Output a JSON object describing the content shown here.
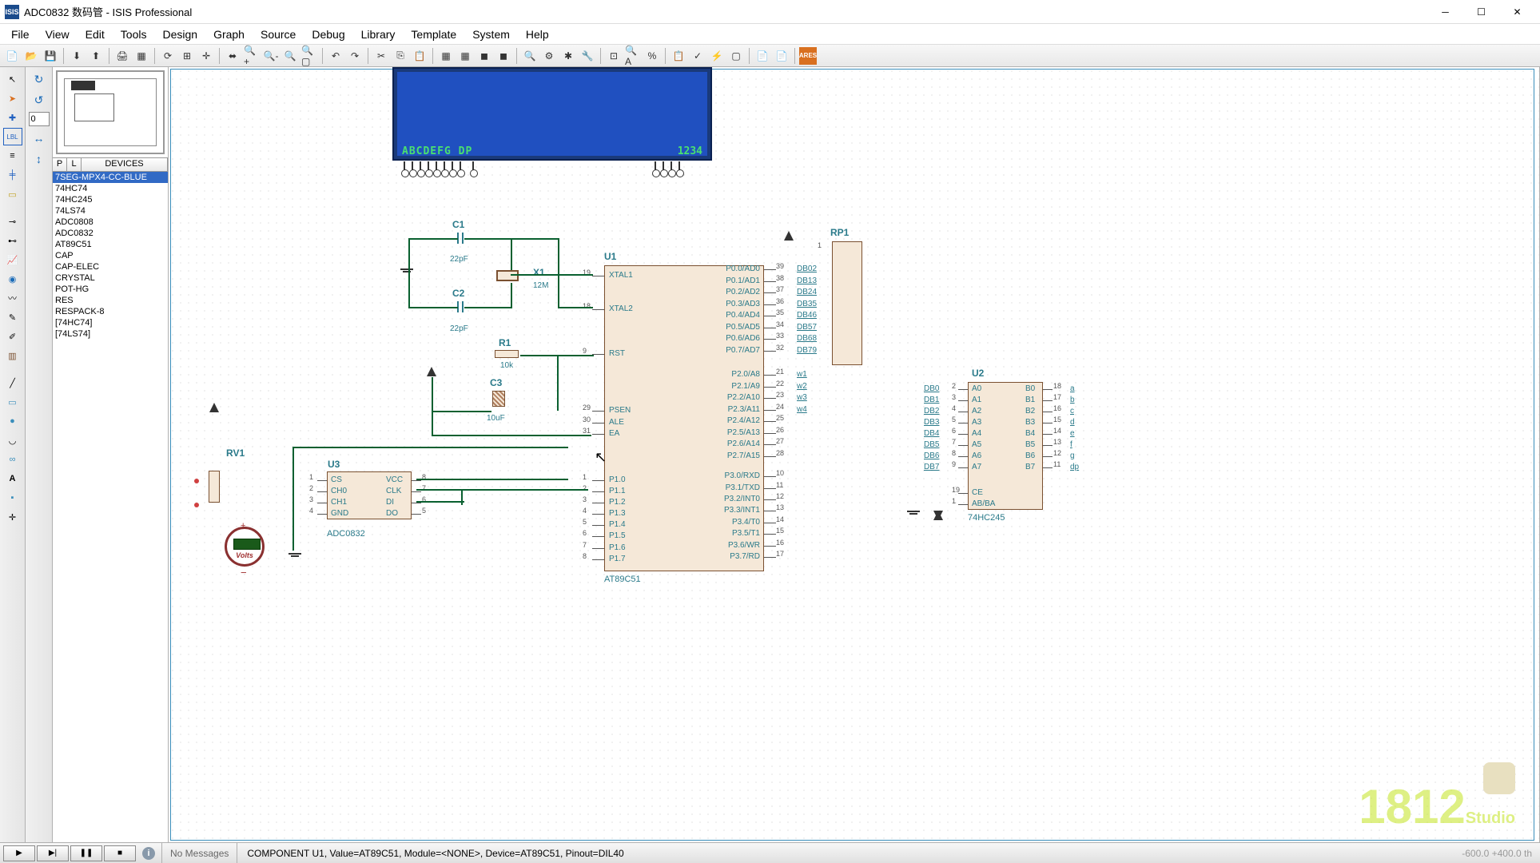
{
  "title": "ADC0832 数码管 - ISIS Professional",
  "menu": [
    "File",
    "View",
    "Edit",
    "Tools",
    "Design",
    "Graph",
    "Source",
    "Debug",
    "Library",
    "Template",
    "System",
    "Help"
  ],
  "deviceHeader": {
    "p": "P",
    "l": "L",
    "d": "DEVICES"
  },
  "devices": [
    "7SEG-MPX4-CC-BLUE",
    "74HC74",
    "74HC245",
    "74LS74",
    "ADC0808",
    "ADC0832",
    "AT89C51",
    "CAP",
    "CAP-ELEC",
    "CRYSTAL",
    "POT-HG",
    "RES",
    "RESPACK-8",
    "[74HC74]",
    "[74LS74]"
  ],
  "selectedDevice": 0,
  "rotationInput": "0",
  "display": {
    "left": "ABCDEFG DP",
    "right": "1234"
  },
  "components": {
    "C1": {
      "ref": "C1",
      "val": "22pF"
    },
    "C2": {
      "ref": "C2",
      "val": "22pF"
    },
    "C3": {
      "ref": "C3",
      "val": "10uF"
    },
    "X1": {
      "ref": "X1",
      "val": "12M"
    },
    "R1": {
      "ref": "R1",
      "val": "10k"
    },
    "RV1": {
      "ref": "RV1"
    },
    "RP1": {
      "ref": "RP1"
    },
    "U1": {
      "ref": "U1",
      "name": "AT89C51"
    },
    "U2": {
      "ref": "U2",
      "name": "74HC245"
    },
    "U3": {
      "ref": "U3",
      "name": "ADC0832"
    },
    "meter": {
      "label": "Volts"
    }
  },
  "u1_pins_left": [
    {
      "num": "19",
      "name": "XTAL1"
    },
    {
      "num": "18",
      "name": "XTAL2"
    },
    {
      "num": "9",
      "name": "RST"
    },
    {
      "num": "29",
      "name": "PSEN"
    },
    {
      "num": "30",
      "name": "ALE"
    },
    {
      "num": "31",
      "name": "EA"
    },
    {
      "num": "1",
      "name": "P1.0"
    },
    {
      "num": "2",
      "name": "P1.1"
    },
    {
      "num": "3",
      "name": "P1.2"
    },
    {
      "num": "4",
      "name": "P1.3"
    },
    {
      "num": "5",
      "name": "P1.4"
    },
    {
      "num": "6",
      "name": "P1.5"
    },
    {
      "num": "7",
      "name": "P1.6"
    },
    {
      "num": "8",
      "name": "P1.7"
    }
  ],
  "u1_pins_right": [
    {
      "num": "39",
      "name": "P0.0/AD0",
      "net": "DB02"
    },
    {
      "num": "38",
      "name": "P0.1/AD1",
      "net": "DB13"
    },
    {
      "num": "37",
      "name": "P0.2/AD2",
      "net": "DB24"
    },
    {
      "num": "36",
      "name": "P0.3/AD3",
      "net": "DB35"
    },
    {
      "num": "35",
      "name": "P0.4/AD4",
      "net": "DB46"
    },
    {
      "num": "34",
      "name": "P0.5/AD5",
      "net": "DB57"
    },
    {
      "num": "33",
      "name": "P0.6/AD6",
      "net": "DB68"
    },
    {
      "num": "32",
      "name": "P0.7/AD7",
      "net": "DB79"
    },
    {
      "num": "21",
      "name": "P2.0/A8",
      "net": "w1"
    },
    {
      "num": "22",
      "name": "P2.1/A9",
      "net": "w2"
    },
    {
      "num": "23",
      "name": "P2.2/A10",
      "net": "w3"
    },
    {
      "num": "24",
      "name": "P2.3/A11",
      "net": "w4"
    },
    {
      "num": "25",
      "name": "P2.4/A12"
    },
    {
      "num": "26",
      "name": "P2.5/A13"
    },
    {
      "num": "27",
      "name": "P2.6/A14"
    },
    {
      "num": "28",
      "name": "P2.7/A15"
    },
    {
      "num": "10",
      "name": "P3.0/RXD"
    },
    {
      "num": "11",
      "name": "P3.1/TXD"
    },
    {
      "num": "12",
      "name": "P3.2/INT0"
    },
    {
      "num": "13",
      "name": "P3.3/INT1"
    },
    {
      "num": "14",
      "name": "P3.4/T0"
    },
    {
      "num": "15",
      "name": "P3.5/T1"
    },
    {
      "num": "16",
      "name": "P3.6/WR"
    },
    {
      "num": "17",
      "name": "P3.7/RD"
    }
  ],
  "u2_pins_left": [
    {
      "num": "2",
      "name": "A0",
      "net": "DB0"
    },
    {
      "num": "3",
      "name": "A1",
      "net": "DB1"
    },
    {
      "num": "4",
      "name": "A2",
      "net": "DB2"
    },
    {
      "num": "5",
      "name": "A3",
      "net": "DB3"
    },
    {
      "num": "6",
      "name": "A4",
      "net": "DB4"
    },
    {
      "num": "7",
      "name": "A5",
      "net": "DB5"
    },
    {
      "num": "8",
      "name": "A6",
      "net": "DB6"
    },
    {
      "num": "9",
      "name": "A7",
      "net": "DB7"
    },
    {
      "num": "19",
      "name": "CE"
    },
    {
      "num": "1",
      "name": "AB/BA"
    }
  ],
  "u2_pins_right": [
    {
      "num": "18",
      "name": "B0",
      "net": "a"
    },
    {
      "num": "17",
      "name": "B1",
      "net": "b"
    },
    {
      "num": "16",
      "name": "B2",
      "net": "c"
    },
    {
      "num": "15",
      "name": "B3",
      "net": "d"
    },
    {
      "num": "14",
      "name": "B4",
      "net": "e"
    },
    {
      "num": "13",
      "name": "B5",
      "net": "f"
    },
    {
      "num": "12",
      "name": "B6",
      "net": "g"
    },
    {
      "num": "11",
      "name": "B7",
      "net": "dp"
    }
  ],
  "u3_pins_left": [
    {
      "num": "1",
      "name": "CS"
    },
    {
      "num": "2",
      "name": "CH0"
    },
    {
      "num": "3",
      "name": "CH1"
    },
    {
      "num": "4",
      "name": "GND"
    }
  ],
  "u3_pins_right": [
    {
      "num": "8",
      "name": "VCC"
    },
    {
      "num": "7",
      "name": "CLK"
    },
    {
      "num": "6",
      "name": "DI"
    },
    {
      "num": "5",
      "name": "DO"
    }
  ],
  "rp1_pin": "1",
  "statusbar": {
    "noMessages": "No Messages",
    "status": "COMPONENT U1, Value=AT89C51, Module=<NONE>, Device=AT89C51, Pinout=DIL40",
    "coords": "-600.0   +400.0   th"
  },
  "watermark": "1812",
  "watermark_sub": "Studio"
}
